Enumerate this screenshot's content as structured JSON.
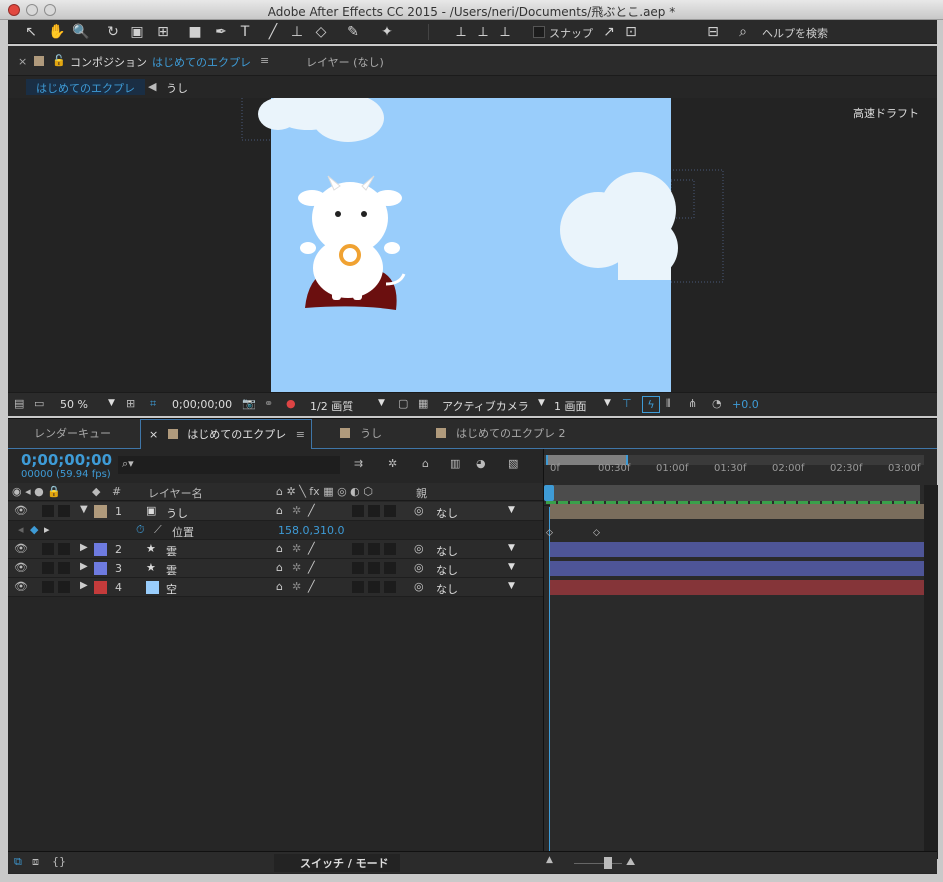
{
  "window": {
    "title": "Adobe After Effects CC 2015 - /Users/neri/Documents/飛ぶとこ.aep *"
  },
  "toolbar": {
    "tools": [
      {
        "icon": "selection-tool-icon",
        "glyph": "↖"
      },
      {
        "icon": "hand-tool-icon",
        "glyph": "✋"
      },
      {
        "icon": "zoom-tool-icon",
        "glyph": "🔍"
      },
      {
        "icon": "rotation-tool-icon",
        "glyph": "↻"
      },
      {
        "icon": "camera-tool-icon",
        "glyph": "▣"
      },
      {
        "icon": "pan-behind-tool-icon",
        "glyph": "⊞"
      },
      {
        "icon": "rectangle-tool-icon",
        "glyph": "■"
      },
      {
        "icon": "pen-tool-icon",
        "glyph": "✒"
      },
      {
        "icon": "type-tool-icon",
        "glyph": "T"
      },
      {
        "icon": "brush-tool-icon",
        "glyph": "╱"
      },
      {
        "icon": "clone-stamp-tool-icon",
        "glyph": "⊥"
      },
      {
        "icon": "eraser-tool-icon",
        "glyph": "◇"
      },
      {
        "icon": "roto-brush-tool-icon",
        "glyph": "✎"
      },
      {
        "icon": "puppet-pin-tool-icon",
        "glyph": "✦"
      }
    ],
    "snap_label": "スナップ",
    "help_search": "ヘルプを検索"
  },
  "comp_panel": {
    "tab_prefix": "コンポジション",
    "tab_comp_name": "はじめてのエクプレ",
    "tab_layer": "レイヤー (なし)",
    "breadcrumb_comp": "はじめてのエクプレ",
    "breadcrumb_layer": "うし",
    "draft_label": "高速ドラフト",
    "zoom": "50 %",
    "timecode": "0;00;00;00",
    "resolution": "1/2 画質",
    "camera": "アクティブカメラ",
    "views": "1 画面",
    "exposure": "+0.0"
  },
  "timeline": {
    "tabs": [
      "レンダーキュー",
      "はじめてのエクプレ",
      "うし",
      "はじめてのエクプレ 2"
    ],
    "current_time": "0;00;00;00",
    "frame_info": "00000 (59.94 fps)",
    "columns": {
      "layer_name": "レイヤー名",
      "parent": "親",
      "num": "#"
    },
    "ruler": [
      "0f",
      "00:30f",
      "01:00f",
      "01:30f",
      "02:00f",
      "02:30f",
      "03:00f"
    ],
    "property": {
      "name": "位置",
      "value": "158.0,310.0"
    },
    "layers": [
      {
        "num": "1",
        "name": "うし",
        "parent": "なし",
        "color": "#b09a7c",
        "bar_color": "#7a6d5c",
        "icon": "comp-icon"
      },
      {
        "num": "2",
        "name": "雲",
        "parent": "なし",
        "color": "#6e7be0",
        "bar_color": "#4e5597",
        "icon": "star-icon"
      },
      {
        "num": "3",
        "name": "雲",
        "parent": "なし",
        "color": "#6e7be0",
        "bar_color": "#4e5597",
        "icon": "star-icon"
      },
      {
        "num": "4",
        "name": "空",
        "parent": "なし",
        "color": "#c43b3b",
        "bar_color": "#853539",
        "icon": "solid-icon"
      }
    ],
    "footer_mode": "スイッチ / モード"
  },
  "colors": {
    "accent": "#3e9bd6",
    "sky": "#99cdfb",
    "cloud": "#eaf4fb",
    "cape": "#6b0f0f",
    "nose_ring": "#f0a232"
  }
}
